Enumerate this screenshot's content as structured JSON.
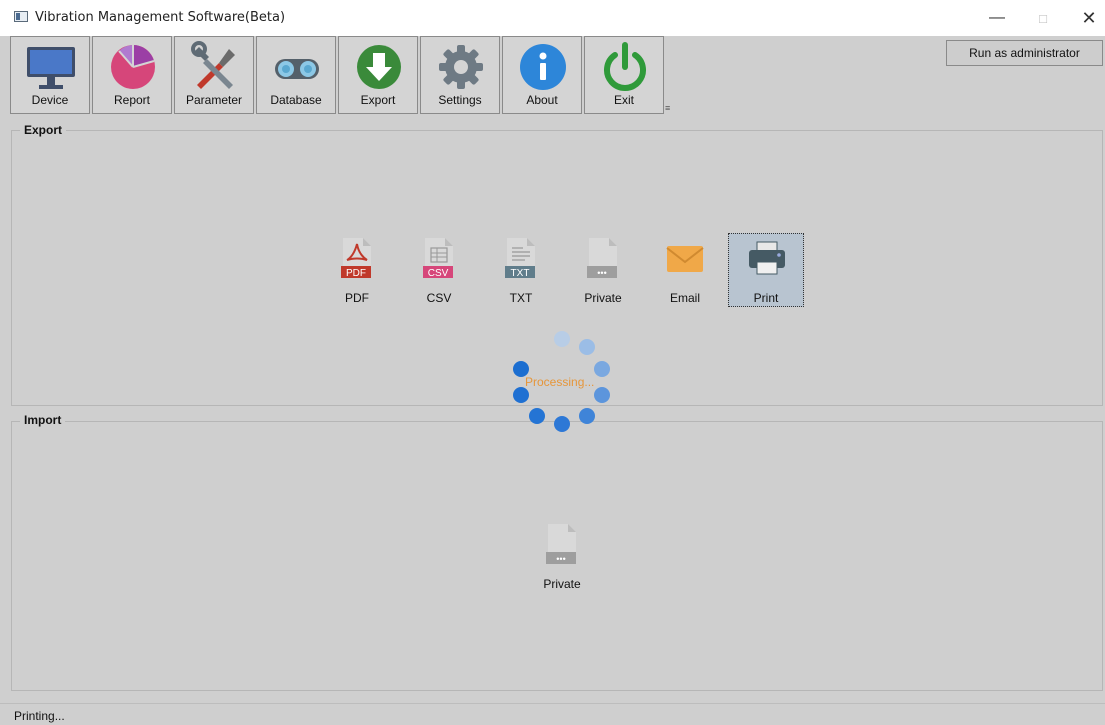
{
  "window": {
    "title": "Vibration Management Software(Beta)",
    "controls": {
      "minimize": "—",
      "maximize": "□",
      "close": "✕"
    }
  },
  "toolbar": {
    "buttons": [
      {
        "label": "Device",
        "icon": "monitor-icon"
      },
      {
        "label": "Report",
        "icon": "pie-chart-icon"
      },
      {
        "label": "Parameter",
        "icon": "tools-icon"
      },
      {
        "label": "Database",
        "icon": "binoculars-icon"
      },
      {
        "label": "Export",
        "icon": "download-icon"
      },
      {
        "label": "Settings",
        "icon": "gear-icon"
      },
      {
        "label": "About",
        "icon": "info-icon"
      },
      {
        "label": "Exit",
        "icon": "power-icon"
      }
    ],
    "overflow": "≡",
    "admin_label": "Run as administrator"
  },
  "export": {
    "title": "Export",
    "items": [
      {
        "label": "PDF",
        "tag": "PDF",
        "color": "#c0392b"
      },
      {
        "label": "CSV",
        "tag": "CSV",
        "color": "#d6467a"
      },
      {
        "label": "TXT",
        "tag": "TXT",
        "color": "#607d8b"
      },
      {
        "label": "Private",
        "tag": "•••",
        "color": "#9e9e9e"
      },
      {
        "label": "Email",
        "tag": "",
        "color": "#f0a848"
      },
      {
        "label": "Print",
        "tag": "",
        "color": "#455a64"
      }
    ],
    "selected": "Print"
  },
  "import": {
    "title": "Import",
    "items": [
      {
        "label": "Private",
        "tag": "•••",
        "color": "#9e9e9e"
      }
    ]
  },
  "overlay": {
    "text": "Processing..."
  },
  "status": {
    "text": "Printing..."
  }
}
